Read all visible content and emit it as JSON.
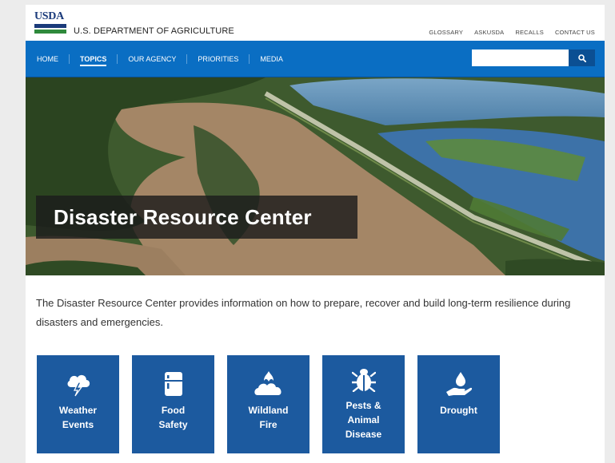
{
  "logo": {
    "text": "USDA"
  },
  "header": {
    "department": "U.S. DEPARTMENT OF AGRICULTURE",
    "utility_links": [
      "GLOSSARY",
      "ASKUSDA",
      "RECALLS",
      "CONTACT US"
    ]
  },
  "nav": {
    "items": [
      {
        "label": "HOME",
        "active": false
      },
      {
        "label": "TOPICS",
        "active": true
      },
      {
        "label": "OUR AGENCY",
        "active": false
      },
      {
        "label": "PRIORITIES",
        "active": false
      },
      {
        "label": "MEDIA",
        "active": false
      }
    ],
    "search_placeholder": ""
  },
  "hero": {
    "title": "Disaster Resource Center"
  },
  "intro": {
    "text": "The Disaster Resource Center provides information on how to prepare, recover and build long-term resilience during disasters and emergencies."
  },
  "tiles": [
    {
      "label": "Weather\nEvents",
      "icon": "storm-cloud-icon"
    },
    {
      "label": "Food\nSafety",
      "icon": "refrigerator-icon"
    },
    {
      "label": "Wildland\nFire",
      "icon": "wildfire-icon"
    },
    {
      "label": "Pests &\nAnimal\nDisease",
      "icon": "bug-icon"
    },
    {
      "label": "Drought",
      "icon": "water-drop-hand-icon"
    }
  ],
  "colors": {
    "nav_blue": "#0a6ec3",
    "tile_blue": "#1c5a9f",
    "usda_blue": "#1a3a7a",
    "usda_green": "#2f8a3c"
  }
}
